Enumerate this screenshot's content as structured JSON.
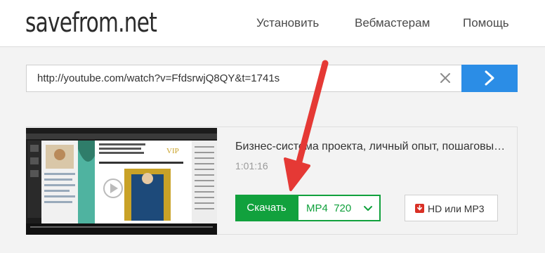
{
  "header": {
    "logo": "savefrom.net",
    "nav": [
      "Установить",
      "Вебмастерам",
      "Помощь"
    ]
  },
  "search": {
    "url": "http://youtube.com/watch?v=FfdsrwjQ8QY&t=1741s"
  },
  "result": {
    "title": "Бизнес-система проекта, личный опыт, пошаговые инструкции",
    "duration": "1:01:16",
    "download_label": "Скачать",
    "format": "MP4",
    "quality": "720",
    "hd_label": "HD или MP3"
  },
  "colors": {
    "accent_blue": "#2b8de6",
    "download_green": "#11a13d",
    "annotation_red": "#e53935"
  },
  "icons": {
    "clear": "close-icon",
    "go": "chevron-right-icon",
    "format_dropdown": "chevron-down-icon",
    "hd": "download-icon"
  }
}
